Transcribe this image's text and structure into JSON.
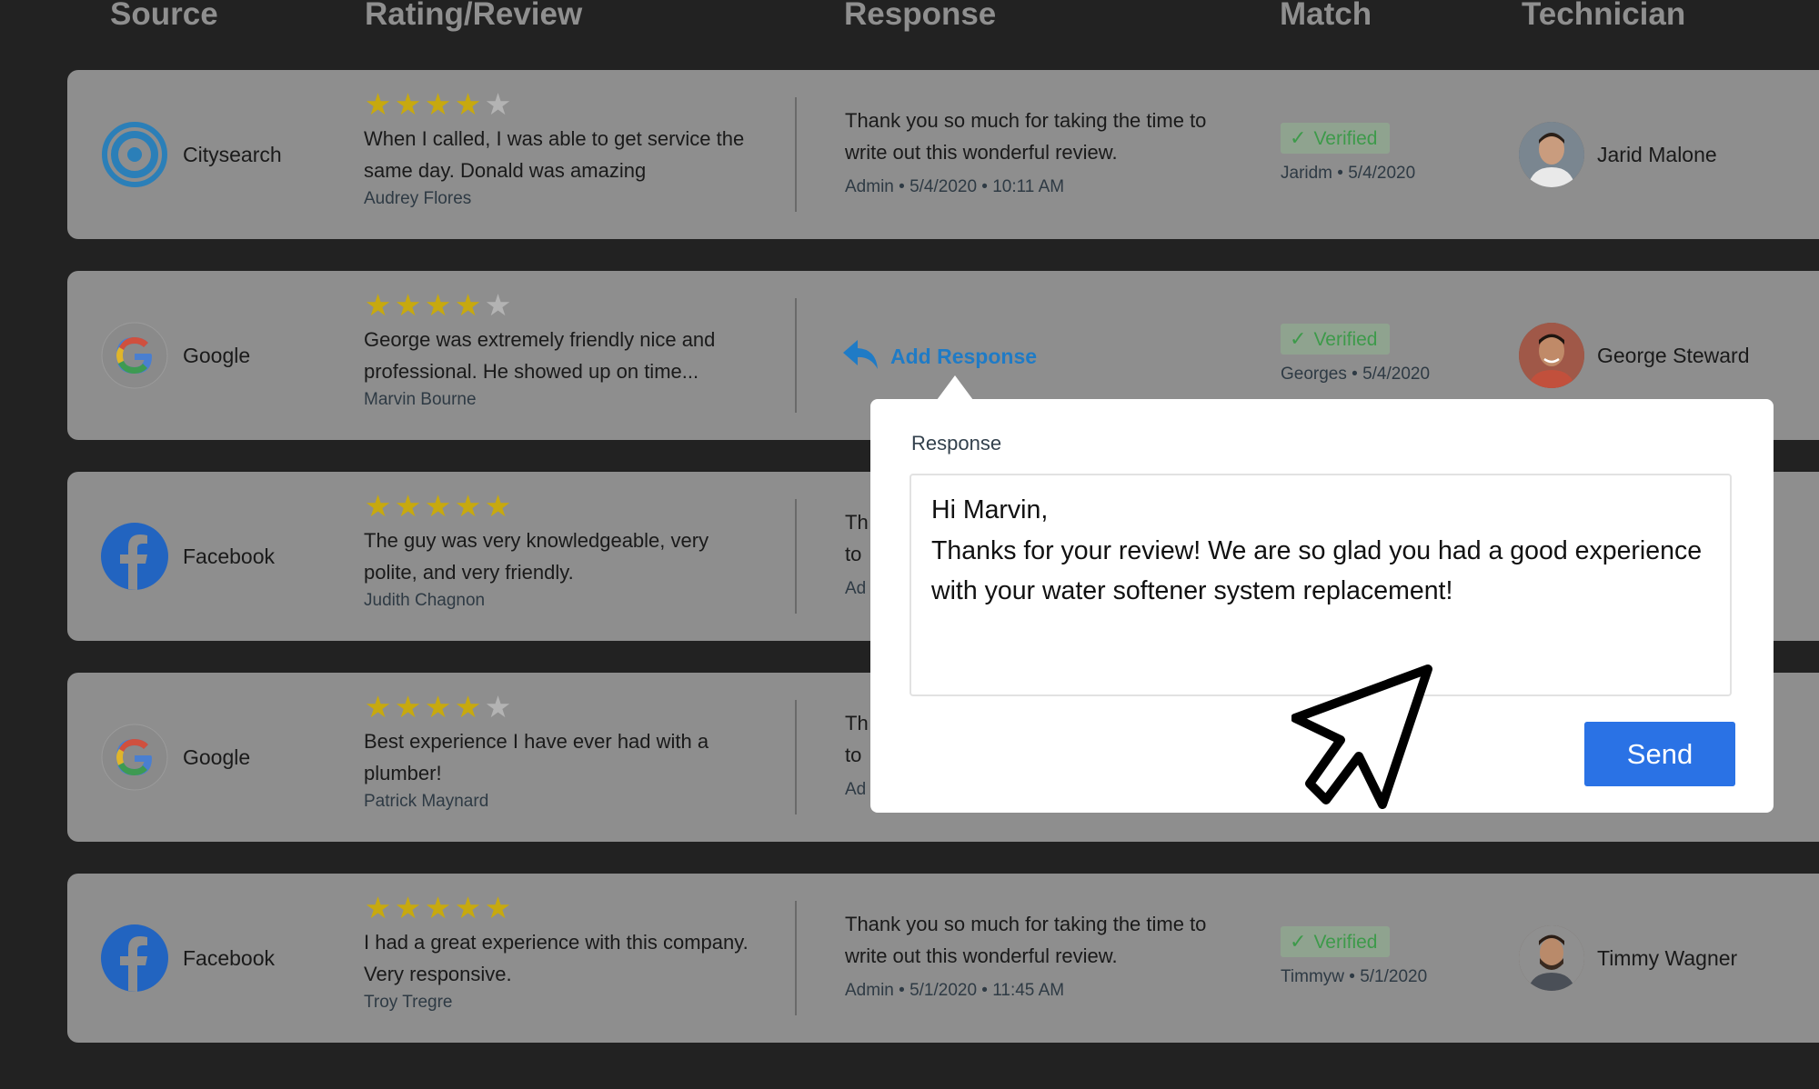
{
  "header": {
    "source": "Source",
    "rating_review": "Rating/Review",
    "response": "Response",
    "match": "Match",
    "technician": "Technician"
  },
  "add_response_label": "Add Response",
  "rows": [
    {
      "source": "Citysearch",
      "source_icon": "citysearch-icon",
      "rating": 4,
      "review": "When I called, I was able to get service the same day. Donald was amazing",
      "reviewer": "Audrey Flores",
      "response": "Thank you so much for taking the time to write out this wonderful review.",
      "response_meta": "Admin • 5/4/2020 • 10:11 AM",
      "match_status": "Verified",
      "match_meta": "Jaridm • 5/4/2020",
      "technician": "Jarid Malone"
    },
    {
      "source": "Google",
      "source_icon": "google-icon",
      "rating": 4,
      "review": "George was extremely friendly nice and professional. He showed up on time...",
      "reviewer": "Marvin Bourne",
      "response": "",
      "response_meta": "",
      "match_status": "Verified",
      "match_meta": "Georges • 5/4/2020",
      "technician": "George Steward"
    },
    {
      "source": "Facebook",
      "source_icon": "facebook-icon",
      "rating": 5,
      "review": "The guy was very knowledgeable, very polite, and very friendly.",
      "reviewer": "Judith Chagnon",
      "response": "Th\nto",
      "response_meta": "Ad",
      "match_status": "",
      "match_meta": "",
      "technician": ""
    },
    {
      "source": "Google",
      "source_icon": "google-icon",
      "rating": 4,
      "review": "Best experience I have ever had with a plumber!",
      "reviewer": "Patrick Maynard",
      "response": "Th\nto",
      "response_meta": "Ad",
      "match_status": "",
      "match_meta": "",
      "technician": ""
    },
    {
      "source": "Facebook",
      "source_icon": "facebook-icon",
      "rating": 5,
      "review": "I had a great experience with this company. Very responsive.",
      "reviewer": "Troy Tregre",
      "response": "Thank you so much for taking the time to write out this wonderful review.",
      "response_meta": "Admin • 5/1/2020 • 11:45 AM",
      "match_status": "Verified",
      "match_meta": "Timmyw • 5/1/2020",
      "technician": "Timmy Wagner"
    }
  ],
  "popover": {
    "label": "Response",
    "text": "Hi Marvin,\nThanks for your review! We are so glad you had a good experience with your water softener system replacement!",
    "send_label": "Send"
  },
  "colors": {
    "background": "#222222",
    "row": "#8e8e8e",
    "star": "#c7a90f",
    "accent": "#1f7bc6",
    "send": "#2a72e5",
    "verified": "#3d9a4a"
  }
}
